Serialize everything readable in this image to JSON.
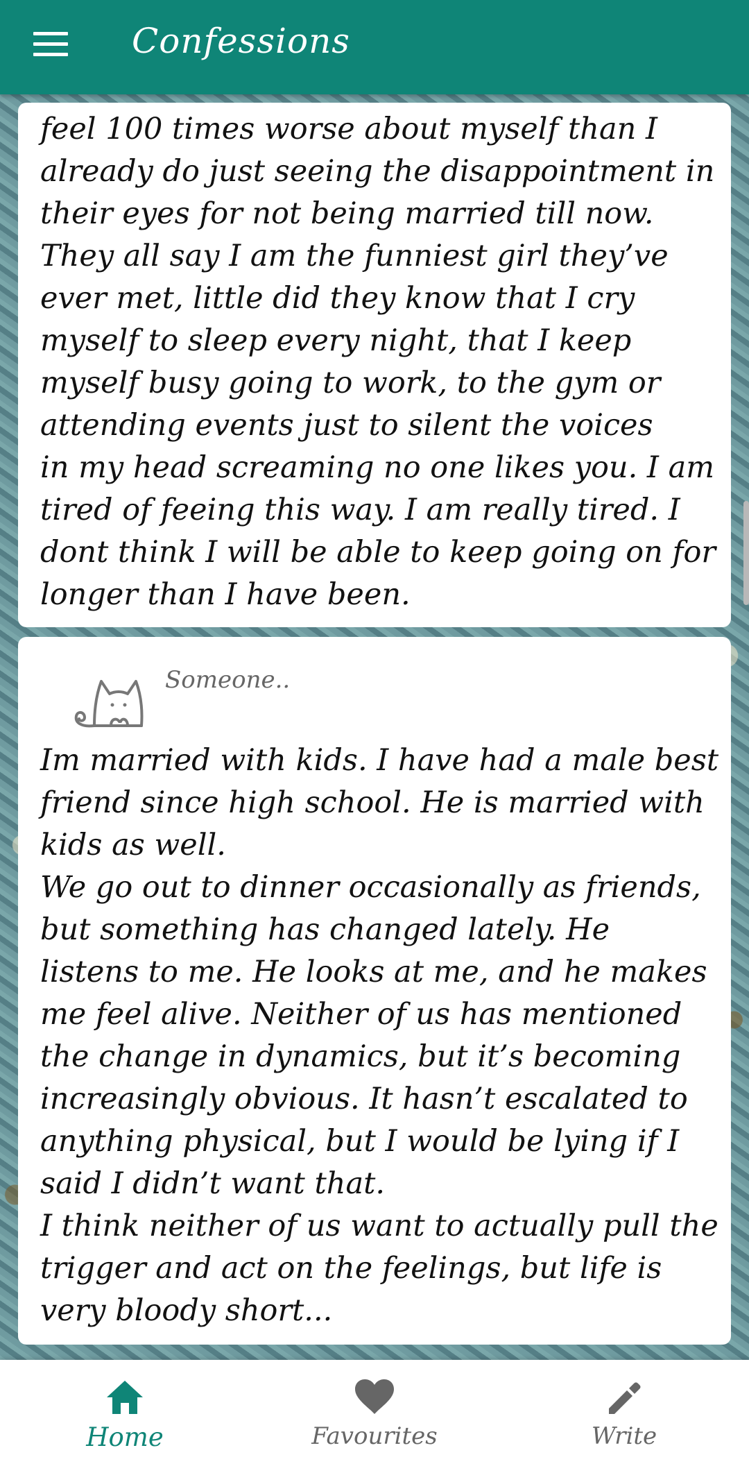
{
  "header": {
    "title": "Confessions",
    "menu_icon": "hamburger-menu-icon",
    "color": "#0f8577"
  },
  "posts": [
    {
      "lines": [
        "feel 100 times worse about myself than I",
        "already do just seeing the disappointment in",
        "their eyes for not being married till now.",
        "They all say I am the funniest girl they’ve",
        "ever met, little did they know that I cry",
        "myself to sleep every night, that I keep",
        "myself busy going to work, to the gym or",
        "attending events just to silent the voices",
        "in my head screaming no one likes you. I am",
        "tired of feeing this way. I am really tired. I",
        "dont think I will be able to keep going on for",
        "longer than I have been."
      ]
    },
    {
      "author": "Someone..",
      "avatar_icon": "cat-icon",
      "lines": [
        "Im married with kids. I have had a male best",
        "friend since high school. He is married with",
        "kids as well.",
        "We go out to dinner occasionally as friends,",
        "but something has changed lately. He",
        "listens to me. He looks at me, and he makes",
        "me feel alive. Neither of us has mentioned",
        "the change in dynamics, but it’s becoming",
        "increasingly obvious. It hasn’t escalated to",
        "anything physical, but I would be lying if I",
        "said I didn’t want that.",
        "I think neither of us want to actually pull the",
        "trigger and act on the feelings, but life is",
        "very bloody short..."
      ]
    }
  ],
  "bottom_nav": {
    "items": [
      {
        "label": "Home",
        "icon": "home-icon",
        "active": true
      },
      {
        "label": "Favourites",
        "icon": "heart-icon",
        "active": false
      },
      {
        "label": "Write",
        "icon": "pencil-icon",
        "active": false
      }
    ],
    "active_color": "#0f8577",
    "inactive_color": "#666666"
  }
}
